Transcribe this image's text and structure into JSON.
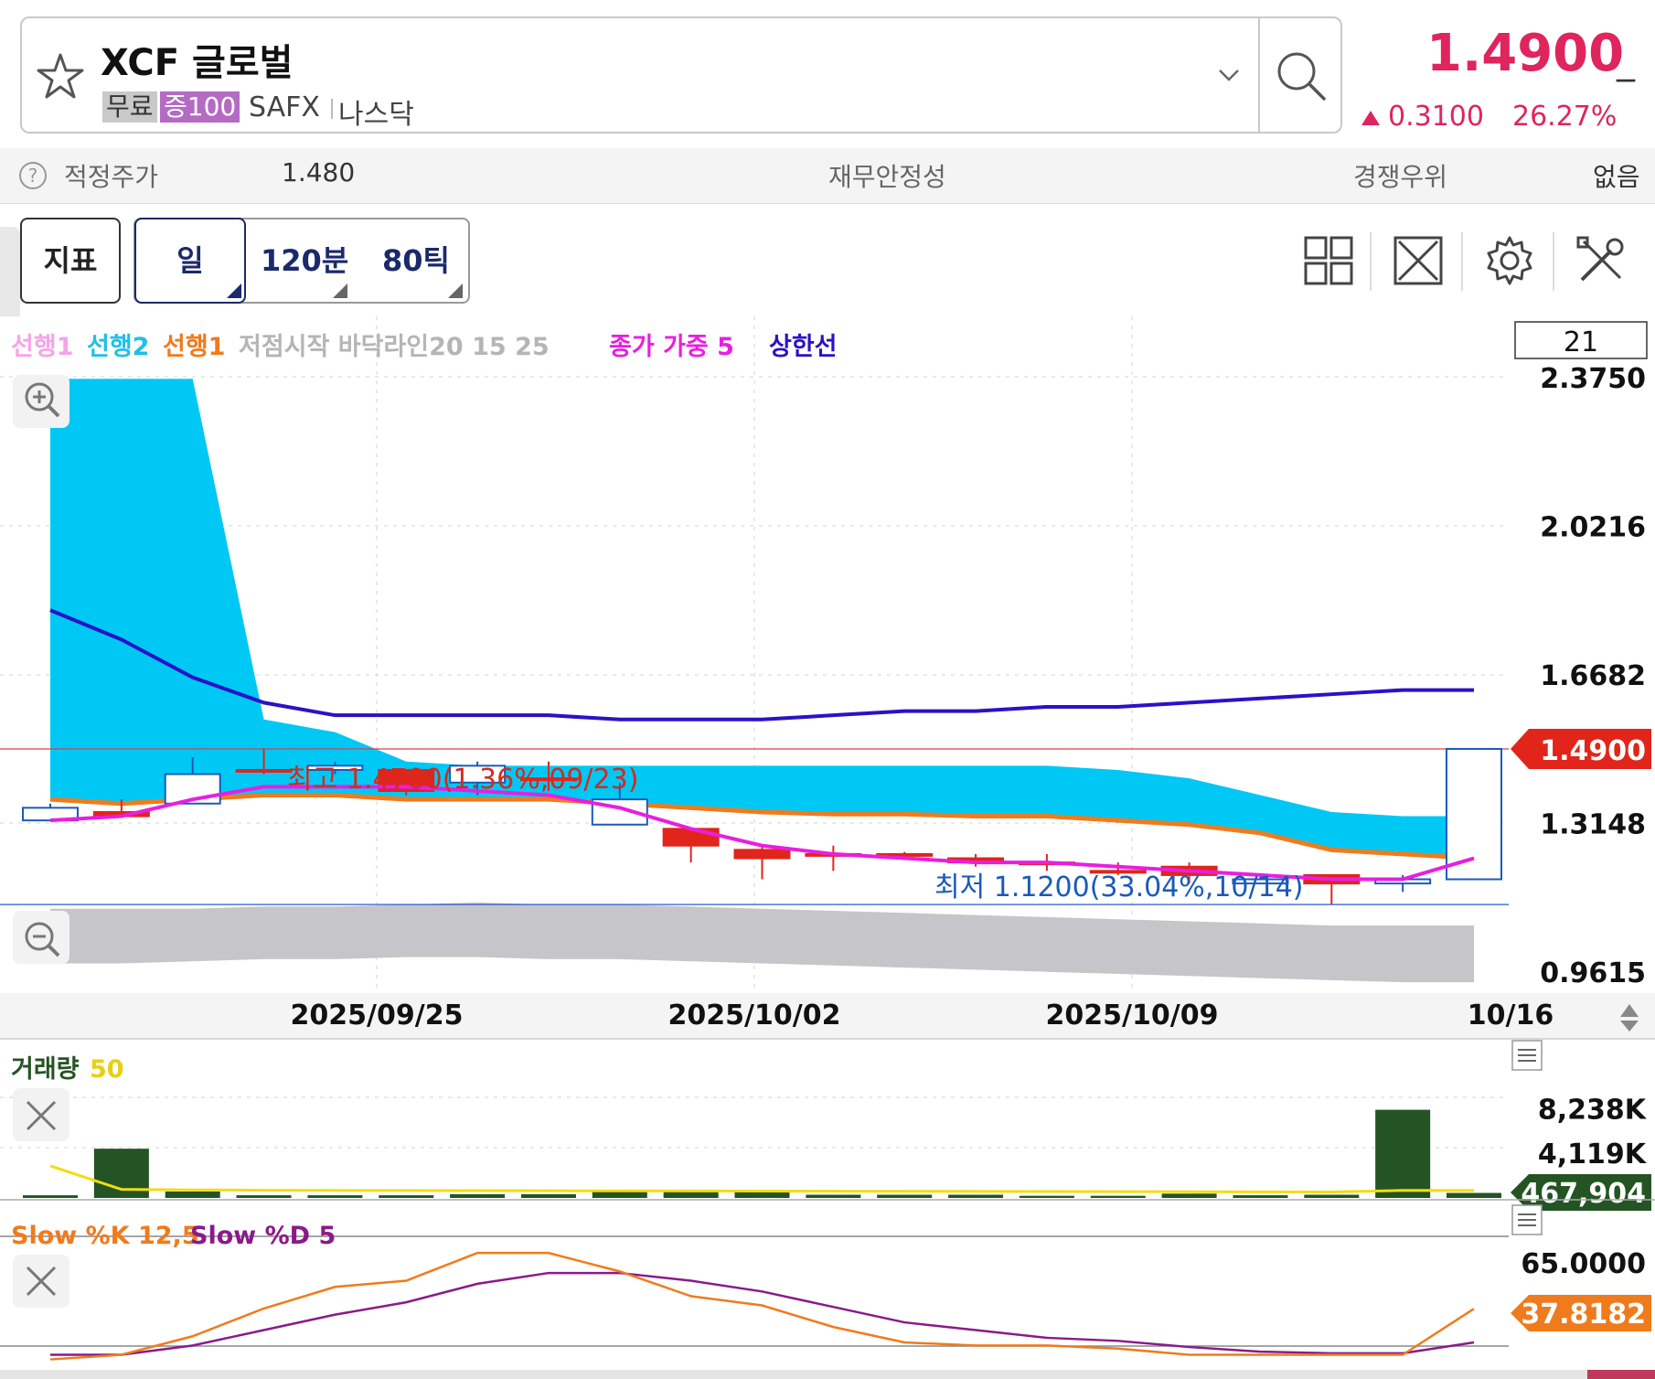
{
  "header": {
    "stock_name": "XCF 글로벌",
    "tag_free": "무료",
    "tag_margin": "증100",
    "exchange": "SAFX",
    "market": "나스닥",
    "price": "1.4900",
    "price_suffix": "_",
    "change": "0.3100",
    "change_pct": "26.27%",
    "up_color": "#e0245e"
  },
  "info_row": {
    "fair_price_label": "적정주가",
    "fair_price_value": "1.480",
    "financial_label": "재무안정성",
    "competitive_label": "경쟁우위",
    "competitive_value": "없음"
  },
  "toolbar": {
    "indicator_label": "지표",
    "periods": [
      "일",
      "120분",
      "80틱"
    ],
    "selected_period": "일",
    "icons": [
      "layout-grid-icon",
      "fullscreen-icon",
      "settings-gear-icon",
      "tools-icon"
    ]
  },
  "chart_data": [
    {
      "type": "candlestick",
      "legend": [
        {
          "text": "선행1",
          "color": "#f7a3e8"
        },
        {
          "text": "선행2",
          "color": "#1ec0e8"
        },
        {
          "text": "선행1",
          "color": "#f07b1c"
        },
        {
          "text": "저점시작 바닥라인20 15 25",
          "color": "#b5b5b5"
        },
        {
          "text": "종가 가중 5",
          "color": "#e91ee0"
        },
        {
          "text": "상한선",
          "color": "#2a12c8"
        }
      ],
      "count_box": "21",
      "y_ticks": [
        "2.3750",
        "2.0216",
        "1.6682",
        "1.3148",
        "0.9615"
      ],
      "y_tick_values": [
        2.375,
        2.0216,
        1.6682,
        1.3148,
        0.9615
      ],
      "ylim": [
        0.9615,
        2.375
      ],
      "x_ticks": [
        "2025/09/25",
        "2025/10/02",
        "2025/10/09",
        "10/16"
      ],
      "current_price_label": "1.4900",
      "current_price": 1.49,
      "high_annotation": "최고 1.4700(1.36%,09/23)",
      "low_annotation": "최저 1.1200(33.04%,10/14)",
      "candles": [
        {
          "o": 1.35,
          "h": 1.36,
          "l": 1.32,
          "c": 1.32
        },
        {
          "o": 1.33,
          "h": 1.37,
          "l": 1.33,
          "c": 1.34
        },
        {
          "o": 1.43,
          "h": 1.47,
          "l": 1.36,
          "c": 1.36
        },
        {
          "o": 1.44,
          "h": 1.49,
          "l": 1.43,
          "c": 1.44
        },
        {
          "o": 1.45,
          "h": 1.46,
          "l": 1.43,
          "c": 1.44
        },
        {
          "o": 1.39,
          "h": 1.44,
          "l": 1.38,
          "c": 1.44
        },
        {
          "o": 1.45,
          "h": 1.46,
          "l": 1.38,
          "c": 1.41
        },
        {
          "o": 1.42,
          "h": 1.46,
          "l": 1.39,
          "c": 1.42
        },
        {
          "o": 1.37,
          "h": 1.41,
          "l": 1.31,
          "c": 1.31
        },
        {
          "o": 1.26,
          "h": 1.3,
          "l": 1.22,
          "c": 1.3
        },
        {
          "o": 1.23,
          "h": 1.26,
          "l": 1.18,
          "c": 1.25
        },
        {
          "o": 1.24,
          "h": 1.26,
          "l": 1.2,
          "c": 1.24
        },
        {
          "o": 1.24,
          "h": 1.245,
          "l": 1.23,
          "c": 1.24
        },
        {
          "o": 1.22,
          "h": 1.24,
          "l": 1.21,
          "c": 1.23
        },
        {
          "o": 1.22,
          "h": 1.24,
          "l": 1.2,
          "c": 1.22
        },
        {
          "o": 1.2,
          "h": 1.22,
          "l": 1.19,
          "c": 1.2
        },
        {
          "o": 1.19,
          "h": 1.22,
          "l": 1.17,
          "c": 1.21
        },
        {
          "o": 1.18,
          "h": 1.19,
          "l": 1.17,
          "c": 1.17
        },
        {
          "o": 1.17,
          "h": 1.18,
          "l": 1.12,
          "c": 1.19
        },
        {
          "o": 1.18,
          "h": 1.19,
          "l": 1.15,
          "c": 1.17
        },
        {
          "o": 1.49,
          "h": 1.49,
          "l": 1.18,
          "c": 1.18
        }
      ],
      "cloud_upper": [
        2.37,
        2.37,
        2.37,
        1.56,
        1.53,
        1.46,
        1.45,
        1.45,
        1.45,
        1.45,
        1.45,
        1.45,
        1.45,
        1.45,
        1.45,
        1.44,
        1.42,
        1.38,
        1.34,
        1.33,
        1.33
      ],
      "cloud_lower": [
        1.37,
        1.36,
        1.37,
        1.38,
        1.38,
        1.37,
        1.37,
        1.37,
        1.36,
        1.35,
        1.34,
        1.335,
        1.335,
        1.33,
        1.33,
        1.32,
        1.31,
        1.29,
        1.25,
        1.24,
        1.23
      ],
      "weighted_close_5": [
        1.32,
        1.33,
        1.37,
        1.4,
        1.4,
        1.4,
        1.39,
        1.38,
        1.35,
        1.3,
        1.26,
        1.24,
        1.23,
        1.22,
        1.22,
        1.21,
        1.2,
        1.19,
        1.18,
        1.18,
        1.23
      ],
      "upper_band": [
        1.82,
        1.75,
        1.66,
        1.6,
        1.57,
        1.57,
        1.57,
        1.57,
        1.56,
        1.56,
        1.56,
        1.57,
        1.58,
        1.58,
        1.59,
        1.59,
        1.6,
        1.61,
        1.62,
        1.63,
        1.63
      ],
      "floor_upper": [
        1.11,
        1.11,
        1.11,
        1.115,
        1.115,
        1.12,
        1.125,
        1.12,
        1.12,
        1.115,
        1.11,
        1.105,
        1.1,
        1.095,
        1.09,
        1.085,
        1.08,
        1.075,
        1.07,
        1.07,
        1.07
      ],
      "floor_lower": [
        0.98,
        0.98,
        0.985,
        0.99,
        0.99,
        0.995,
        0.995,
        0.99,
        0.99,
        0.985,
        0.98,
        0.975,
        0.97,
        0.965,
        0.96,
        0.955,
        0.95,
        0.945,
        0.94,
        0.935,
        0.935
      ]
    },
    {
      "type": "bar",
      "title": "거래량",
      "ma_label": "50",
      "y_ticks": [
        "8,238K",
        "4,119K"
      ],
      "y_tick_values": [
        8238000,
        4119000
      ],
      "current_label": "467,904",
      "values": [
        250000,
        4600000,
        600000,
        250000,
        250000,
        250000,
        350000,
        350000,
        600000,
        600000,
        650000,
        300000,
        300000,
        300000,
        200000,
        200000,
        400000,
        250000,
        300000,
        8238000,
        467904
      ],
      "ma": [
        3000000,
        800000,
        750000,
        720000,
        700000,
        690000,
        680000,
        670000,
        660000,
        650000,
        640000,
        630000,
        620000,
        610000,
        600000,
        590000,
        580000,
        570000,
        560000,
        700000,
        690000
      ],
      "ylim": [
        0,
        9400000
      ]
    },
    {
      "type": "line",
      "title_k": "Slow %K 12,5",
      "title_d": "Slow %D 5",
      "y_ticks": [
        "65.0000"
      ],
      "y_tick_values": [
        65
      ],
      "current_label": "37.8182",
      "slow_k": [
        5,
        8,
        20,
        38,
        52,
        56,
        74,
        74,
        62,
        46,
        40,
        26,
        16,
        14,
        14,
        12,
        8,
        8,
        8,
        8,
        37.8182
      ],
      "slow_d": [
        8,
        8,
        14,
        24,
        34,
        42,
        54,
        61,
        61,
        56,
        49,
        39,
        29,
        24,
        19,
        17,
        13,
        10,
        9,
        9,
        16
      ],
      "ylim": [
        0,
        80
      ]
    }
  ]
}
